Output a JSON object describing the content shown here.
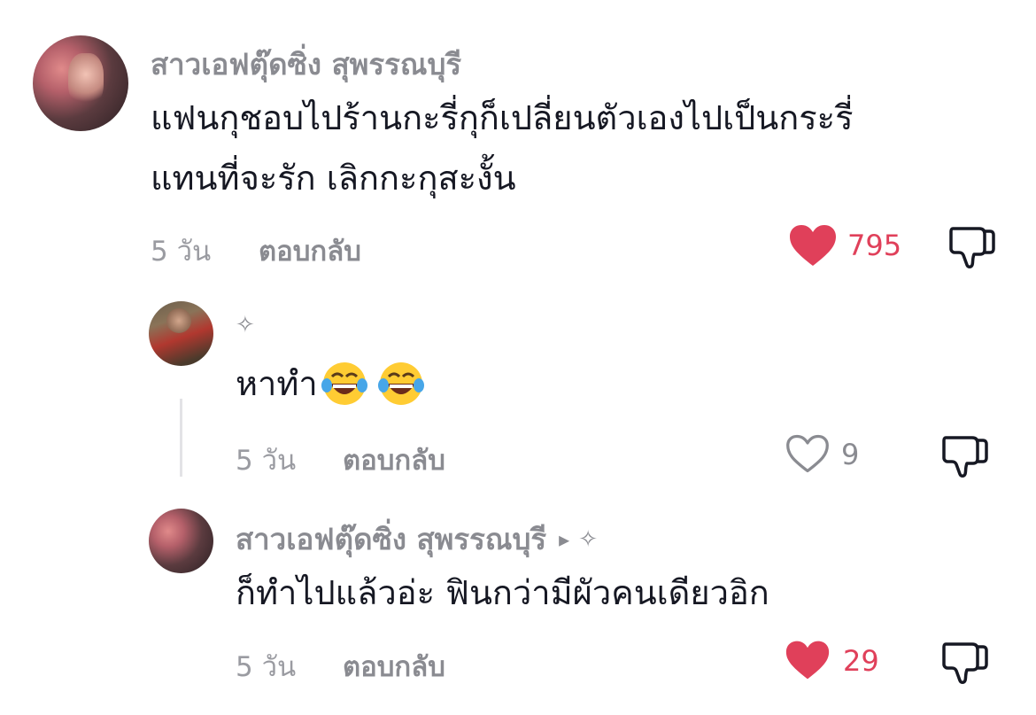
{
  "comment": {
    "username": "สาวเอฟตุ๊ดซิ่ง สุพรรณบุรี",
    "text_line1": "แฟนกุชอบไปร้านกะรี่กุก็เปลี่ยนตัวเองไปเป็นกระรี่",
    "text_line2": "แทนที่จะรัก เลิกกะกุสะงั้น",
    "time": "5 วัน",
    "reply_label": "ตอบกลับ",
    "likes": "795",
    "liked": true
  },
  "replies": [
    {
      "username_symbol": "✧",
      "text": "หาทำ",
      "emojis": [
        "face-with-tears-of-joy",
        "face-with-tears-of-joy"
      ],
      "time": "5 วัน",
      "reply_label": "ตอบกลับ",
      "likes": "9",
      "liked": false
    },
    {
      "username": "สาวเอฟตุ๊ดซิ่ง สุพรรณบุรี",
      "reply_arrow": "▸",
      "reply_to_symbol": "✧",
      "text": "ก็ทำไปแล้วอ่ะ ฟินกว่ามีผัวคนเดียวอิก",
      "time": "5 วัน",
      "reply_label": "ตอบกลับ",
      "likes": "29",
      "liked": true
    }
  ],
  "colors": {
    "like_red": "#e0405a",
    "meta_gray": "#8a8b91",
    "text": "#161823"
  },
  "icons": [
    "heart-filled-icon",
    "heart-outline-icon",
    "dislike-icon"
  ]
}
